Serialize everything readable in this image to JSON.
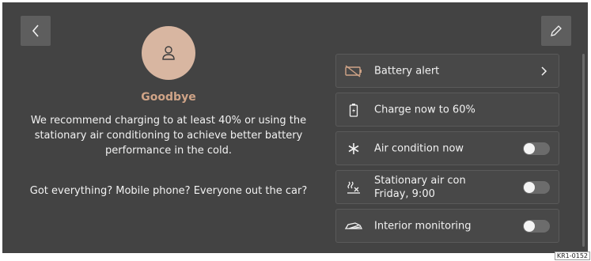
{
  "profile": {
    "greeting": "Goodbye",
    "message": "We recommend charging to at least 40% or using the stationary air conditioning to achieve better battery performance in the cold.",
    "question": "Got everything? Mobile phone? Everyone out the car?"
  },
  "settings": [
    {
      "label": "Battery alert",
      "icon": "battery-alert-icon",
      "control": "chevron"
    },
    {
      "label": "Charge now to 60%",
      "icon": "battery-charge-icon",
      "control": "none"
    },
    {
      "label": "Air condition now",
      "icon": "snowflake-icon",
      "control": "toggle",
      "on": false
    },
    {
      "label": "Stationary air con",
      "sublabel": "Friday, 9:00",
      "icon": "climate-timer-icon",
      "control": "toggle",
      "on": false
    },
    {
      "label": "Interior monitoring",
      "icon": "car-interior-icon",
      "control": "toggle",
      "on": false
    }
  ],
  "image_code": "KR1-0152",
  "colors": {
    "background": "#434343",
    "accent": "#d0a487",
    "avatar": "#d8b6a1"
  }
}
